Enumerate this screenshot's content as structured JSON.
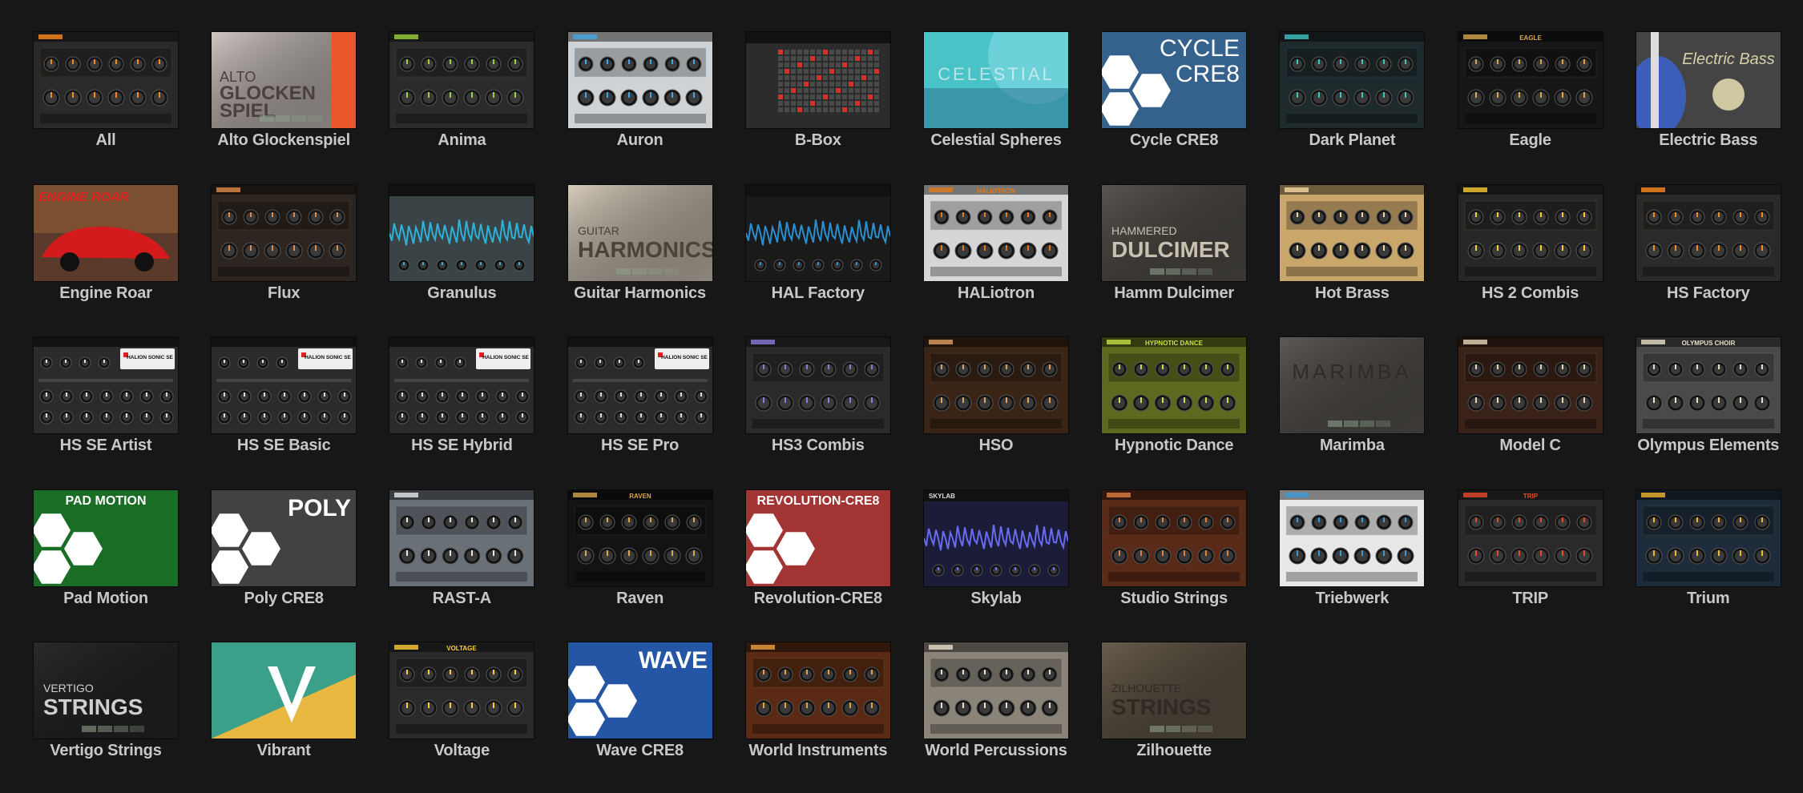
{
  "tiles": [
    {
      "label": "All",
      "icon": "all-plugins-thumbnail-icon"
    },
    {
      "label": "Alto Glockenspiel",
      "icon": "alto-glockenspiel-thumbnail-icon",
      "thumb_text": [
        "ALTO",
        "GLOCKEN",
        "SPIEL"
      ]
    },
    {
      "label": "Anima",
      "icon": "anima-thumbnail-icon"
    },
    {
      "label": "Auron",
      "icon": "auron-thumbnail-icon"
    },
    {
      "label": "B-Box",
      "icon": "b-box-thumbnail-icon"
    },
    {
      "label": "Celestial Spheres",
      "icon": "celestial-spheres-thumbnail-icon",
      "thumb_text": [
        "CELESTIAL"
      ]
    },
    {
      "label": "Cycle CRE8",
      "icon": "cycle-cre8-thumbnail-icon",
      "thumb_text": [
        "CYCLE",
        "CRE8"
      ]
    },
    {
      "label": "Dark Planet",
      "icon": "dark-planet-thumbnail-icon"
    },
    {
      "label": "Eagle",
      "icon": "eagle-thumbnail-icon",
      "thumb_text": [
        "EAGLE"
      ]
    },
    {
      "label": "Electric Bass",
      "icon": "electric-bass-thumbnail-icon",
      "thumb_text": [
        "Electric Bass"
      ]
    },
    {
      "label": "Engine Roar",
      "icon": "engine-roar-thumbnail-icon",
      "thumb_text": [
        "ENGINE ROAR"
      ]
    },
    {
      "label": "Flux",
      "icon": "flux-thumbnail-icon"
    },
    {
      "label": "Granulus",
      "icon": "granulus-thumbnail-icon"
    },
    {
      "label": "Guitar Harmonics",
      "icon": "guitar-harmonics-thumbnail-icon",
      "thumb_text": [
        "GUITAR",
        "HARMONICS"
      ]
    },
    {
      "label": "HAL Factory",
      "icon": "hal-factory-thumbnail-icon"
    },
    {
      "label": "HALiotron",
      "icon": "haliotron-thumbnail-icon",
      "thumb_text": [
        "HALIOTRON"
      ]
    },
    {
      "label": "Hamm Dulcimer",
      "icon": "hamm-dulcimer-thumbnail-icon",
      "thumb_text": [
        "HAMMERED",
        "DULCIMER"
      ]
    },
    {
      "label": "Hot Brass",
      "icon": "hot-brass-thumbnail-icon"
    },
    {
      "label": "HS 2 Combis",
      "icon": "hs-2-combis-thumbnail-icon"
    },
    {
      "label": "HS Factory",
      "icon": "hs-factory-thumbnail-icon"
    },
    {
      "label": "HS SE Artist",
      "icon": "hs-se-artist-thumbnail-icon",
      "thumb_text": [
        "HALION SONIC SE"
      ]
    },
    {
      "label": "HS SE Basic",
      "icon": "hs-se-basic-thumbnail-icon",
      "thumb_text": [
        "HALION SONIC SE"
      ]
    },
    {
      "label": "HS SE Hybrid",
      "icon": "hs-se-hybrid-thumbnail-icon",
      "thumb_text": [
        "HALION SONIC SE"
      ]
    },
    {
      "label": "HS SE Pro",
      "icon": "hs-se-pro-thumbnail-icon",
      "thumb_text": [
        "HALION SONIC SE"
      ]
    },
    {
      "label": "HS3 Combis",
      "icon": "hs3-combis-thumbnail-icon"
    },
    {
      "label": "HSO",
      "icon": "hso-thumbnail-icon"
    },
    {
      "label": "Hypnotic Dance",
      "icon": "hypnotic-dance-thumbnail-icon",
      "thumb_text": [
        "HYPNOTIC DANCE"
      ]
    },
    {
      "label": "Marimba",
      "icon": "marimba-thumbnail-icon",
      "thumb_text": [
        "MARIMBA"
      ]
    },
    {
      "label": "Model C",
      "icon": "model-c-thumbnail-icon"
    },
    {
      "label": "Olympus Elements",
      "icon": "olympus-elements-thumbnail-icon",
      "thumb_text": [
        "OLYMPUS CHOIR"
      ]
    },
    {
      "label": "Pad Motion",
      "icon": "pad-motion-thumbnail-icon",
      "thumb_text": [
        "PAD MOTION"
      ]
    },
    {
      "label": "Poly CRE8",
      "icon": "poly-cre8-thumbnail-icon",
      "thumb_text": [
        "POLY"
      ]
    },
    {
      "label": "RAST-A",
      "icon": "rast-a-thumbnail-icon"
    },
    {
      "label": "Raven",
      "icon": "raven-thumbnail-icon",
      "thumb_text": [
        "RAVEN"
      ]
    },
    {
      "label": "Revolution-CRE8",
      "icon": "revolution-cre8-thumbnail-icon",
      "thumb_text": [
        "REVOLUTION-CRE8"
      ]
    },
    {
      "label": "Skylab",
      "icon": "skylab-thumbnail-icon",
      "thumb_text": [
        "SKYLAB"
      ]
    },
    {
      "label": "Studio Strings",
      "icon": "studio-strings-thumbnail-icon"
    },
    {
      "label": "Triebwerk",
      "icon": "triebwerk-thumbnail-icon"
    },
    {
      "label": "TRIP",
      "icon": "trip-thumbnail-icon",
      "thumb_text": [
        "TRIP"
      ]
    },
    {
      "label": "Trium",
      "icon": "trium-thumbnail-icon"
    },
    {
      "label": "Vertigo Strings",
      "icon": "vertigo-strings-thumbnail-icon",
      "thumb_text": [
        "VERTIGO",
        "STRINGS"
      ]
    },
    {
      "label": "Vibrant",
      "icon": "vibrant-thumbnail-icon"
    },
    {
      "label": "Voltage",
      "icon": "voltage-thumbnail-icon",
      "thumb_text": [
        "VOLTAGE"
      ]
    },
    {
      "label": "Wave CRE8",
      "icon": "wave-cre8-thumbnail-icon",
      "thumb_text": [
        "WAVE"
      ]
    },
    {
      "label": "World Instruments",
      "icon": "world-instruments-thumbnail-icon"
    },
    {
      "label": "World Percussions",
      "icon": "world-percussions-thumbnail-icon"
    },
    {
      "label": "Zilhouette",
      "icon": "zilhouette-thumbnail-icon",
      "thumb_text": [
        "ZILHOUETTE",
        "STRINGS"
      ]
    }
  ]
}
